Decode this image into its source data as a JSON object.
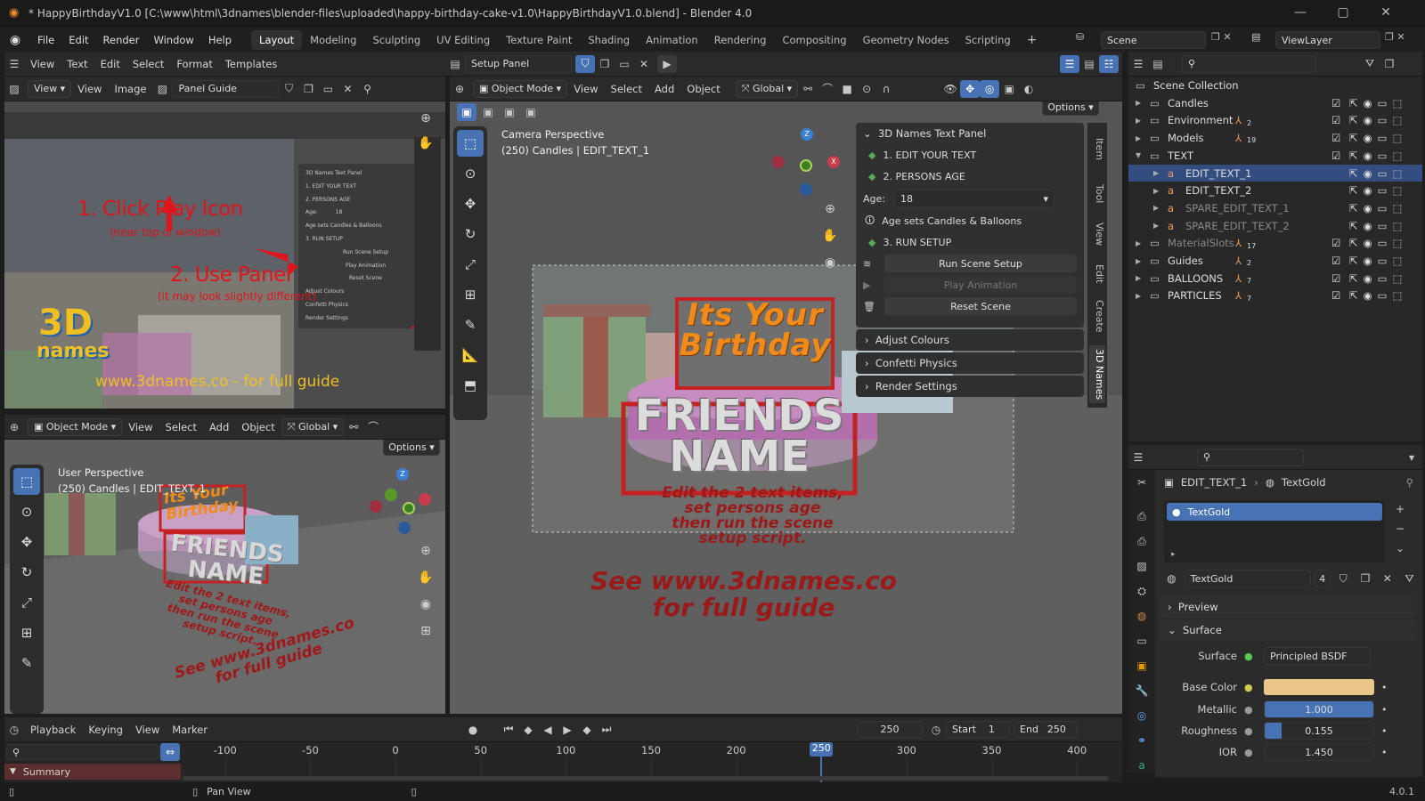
{
  "titlebar": {
    "title": "* HappyBirthdayV1.0 [C:\\www\\html\\3dnames\\blender-files\\uploaded\\happy-birthday-cake-v1.0\\HappyBirthdayV1.0.blend] - Blender 4.0"
  },
  "menubar": {
    "menus": [
      "File",
      "Edit",
      "Render",
      "Window",
      "Help"
    ],
    "workspaces": [
      "Layout",
      "Modeling",
      "Sculpting",
      "UV Editing",
      "Texture Paint",
      "Shading",
      "Animation",
      "Rendering",
      "Compositing",
      "Geometry Nodes",
      "Scripting"
    ],
    "active_workspace": "Layout",
    "scene": "Scene",
    "view_layer": "ViewLayer"
  },
  "text_editor_header": {
    "menus": [
      "View",
      "Text",
      "Edit",
      "Select",
      "Format",
      "Templates"
    ],
    "text_name": "Setup Panel"
  },
  "image_editor": {
    "menus": [
      "View",
      "View",
      "Image"
    ],
    "image_name": "Panel Guide",
    "guide": {
      "step1": "1. Click Play Icon",
      "step1_note": "(near top of window)",
      "step2": "2. Use Panel",
      "step2_note": "(it may look slightly different)",
      "logo_line1": "3D",
      "logo_line2": "names",
      "url": "www.3dnames.co - for full guide",
      "mini_panel": {
        "title": "3D Names Text Panel",
        "items": [
          "1. EDIT YOUR TEXT",
          "2. PERSONS AGE",
          "Age:",
          "18",
          "Age sets Candles & Balloons",
          "3. RUN SETUP",
          "Run Scene Setup",
          "Play Animation",
          "Reset Scene",
          "Adjust Colours",
          "Confetti Physics",
          "Render Settings"
        ]
      }
    }
  },
  "viewport_main": {
    "mode": "Object Mode",
    "menus": [
      "View",
      "Select",
      "Add",
      "Object"
    ],
    "orientation": "Global",
    "options": "Options",
    "camera_label": "Camera Perspective",
    "object_label": "(250) Candles | EDIT_TEXT_1",
    "scene_text": {
      "sign_line1": "Its Your",
      "sign_line2": "Birthday",
      "name_line1": "FRIENDS",
      "name_line2": "NAME",
      "instructions": [
        "Edit the 2 text items,",
        "set persons age",
        "then run the scene",
        "setup script."
      ],
      "guide": [
        "See www.3dnames.co",
        "for full guide"
      ]
    },
    "gizmo_axes": {
      "z": "Z",
      "x": "X",
      "y": "Y"
    },
    "side_tabs": [
      "Item",
      "Tool",
      "View",
      "Edit",
      "Create",
      "3D Names"
    ]
  },
  "names_panel": {
    "title": "3D Names Text Panel",
    "step1": "1. EDIT YOUR TEXT",
    "step2": "2. PERSONS AGE",
    "age_label": "Age:",
    "age_value": "18",
    "age_note": "Age sets Candles & Balloons",
    "step3": "3. RUN SETUP",
    "run_button": "Run Scene Setup",
    "play_button": "Play Animation",
    "reset_button": "Reset Scene",
    "sections": [
      "Adjust Colours",
      "Confetti Physics",
      "Render Settings"
    ]
  },
  "viewport_small": {
    "mode": "Object Mode",
    "menus": [
      "View",
      "Select",
      "Add",
      "Object"
    ],
    "orientation": "Global",
    "options": "Options",
    "persp_label": "User Perspective",
    "object_label": "(250) Candles | EDIT_TEXT_1",
    "scene_text": {
      "sign_line1": "Its Your",
      "sign_line2": "Birthday",
      "name_line1": "FRIENDS",
      "name_line2": "NAME",
      "instructions": [
        "Edit the 2 text items,",
        "set persons age",
        "then run the scene",
        "setup script."
      ],
      "guide": [
        "See www.3dnames.co",
        "for full guide"
      ]
    }
  },
  "outliner": {
    "root": "Scene Collection",
    "rows": [
      {
        "label": "Candles",
        "indent": 0,
        "badge": ""
      },
      {
        "label": "Environment",
        "indent": 0,
        "badge": "2"
      },
      {
        "label": "Models",
        "indent": 0,
        "badge": "19"
      },
      {
        "label": "TEXT",
        "indent": 0,
        "badge": ""
      },
      {
        "label": "EDIT_TEXT_1",
        "indent": 1,
        "badge": ""
      },
      {
        "label": "EDIT_TEXT_2",
        "indent": 1,
        "badge": ""
      },
      {
        "label": "SPARE_EDIT_TEXT_1",
        "indent": 1,
        "badge": ""
      },
      {
        "label": "SPARE_EDIT_TEXT_2",
        "indent": 1,
        "badge": ""
      },
      {
        "label": "MaterialSlots",
        "indent": 0,
        "badge": "17"
      },
      {
        "label": "Guides",
        "indent": 0,
        "badge": "2"
      },
      {
        "label": "BALLOONS",
        "indent": 0,
        "badge": "7"
      },
      {
        "label": "PARTICLES",
        "indent": 0,
        "badge": "7"
      }
    ],
    "selected_row": "EDIT_TEXT_1"
  },
  "properties": {
    "breadcrumb_object": "EDIT_TEXT_1",
    "breadcrumb_material": "TextGold",
    "slot_name": "TextGold",
    "material_name": "TextGold",
    "users": "4",
    "preview_label": "Preview",
    "surface_section": "Surface",
    "surface_label": "Surface",
    "surface_value": "Principled BSDF",
    "base_color_label": "Base Color",
    "base_color": "#ecc58a",
    "metallic_label": "Metallic",
    "metallic_value": "1.000",
    "metallic_fraction": 1.0,
    "roughness_label": "Roughness",
    "roughness_value": "0.155",
    "roughness_fraction": 0.155,
    "ior_label": "IOR",
    "ior_value": "1.450"
  },
  "timeline": {
    "menus": [
      "Playback",
      "Keying",
      "View",
      "Marker"
    ],
    "current_frame": "250",
    "start_label": "Start",
    "start_value": "1",
    "end_label": "End",
    "end_value": "250",
    "ticks": [
      "-100",
      "-50",
      "0",
      "50",
      "100",
      "150",
      "200",
      "250",
      "300",
      "350",
      "400"
    ],
    "tick_values": [
      -100,
      -50,
      0,
      50,
      100,
      150,
      200,
      250,
      300,
      350,
      400
    ],
    "playhead_frame": 250,
    "summary": "Summary"
  },
  "statusbar": {
    "hint": "Pan View",
    "version": "4.0.1"
  },
  "colors": {
    "accent": "#4772b3",
    "selection": "#334d80",
    "orange": "#ee9e5a",
    "red_annotation": "#e0141b"
  }
}
